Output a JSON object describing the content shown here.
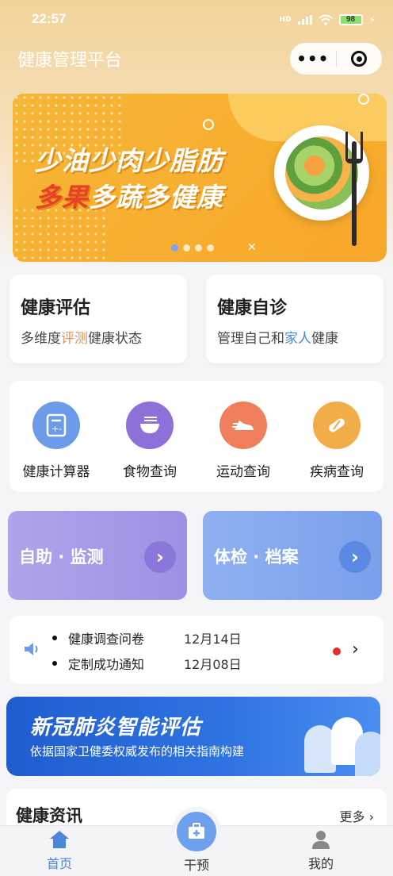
{
  "status_bar": {
    "time": "22:57",
    "network": "HD",
    "battery": "98"
  },
  "header": {
    "title": "健康管理平台"
  },
  "banner": {
    "line1": "少油少肉少脂肪",
    "line2_highlight": "多果",
    "line2_rest": "多蔬多健康",
    "active_indicator": 0,
    "indicator_count": 4
  },
  "assess_cards": [
    {
      "title": "健康评估",
      "sub_pre": "多维度",
      "sub_hl": "评测",
      "sub_post": "健康状态"
    },
    {
      "title": "健康自诊",
      "sub_pre": "管理自己和",
      "sub_hl": "家人",
      "sub_post": "健康"
    }
  ],
  "tools": [
    {
      "label": "健康计算器",
      "icon": "calculator-icon",
      "color": "#6c9be9"
    },
    {
      "label": "食物查询",
      "icon": "food-bowl-icon",
      "color": "#8f6fd8"
    },
    {
      "label": "运动查询",
      "icon": "running-shoe-icon",
      "color": "#f07f5e"
    },
    {
      "label": "疾病查询",
      "icon": "pill-icon",
      "color": "#f2ac4a"
    }
  ],
  "features": [
    {
      "label": "自助 · 监测",
      "color": "#a496e6",
      "btn_color": "#8a77db"
    },
    {
      "label": "体检 · 档案",
      "color": "#7ea4ef",
      "btn_color": "#5c8ae3"
    }
  ],
  "notices": [
    {
      "title": "健康调查问卷",
      "date": "12月14日"
    },
    {
      "title": "定制成功通知",
      "date": "12月08日"
    }
  ],
  "covid_banner": {
    "title": "新冠肺炎智能评估",
    "subtitle": "依据国家卫健委权威发布的相关指南构建"
  },
  "news": {
    "title": "健康资讯",
    "more": "更多"
  },
  "tabbar": [
    {
      "label": "首页",
      "icon": "home-icon",
      "active": true
    },
    {
      "label": "干预",
      "icon": "medical-kit-icon",
      "active": false
    },
    {
      "label": "我的",
      "icon": "user-icon",
      "active": false
    }
  ]
}
